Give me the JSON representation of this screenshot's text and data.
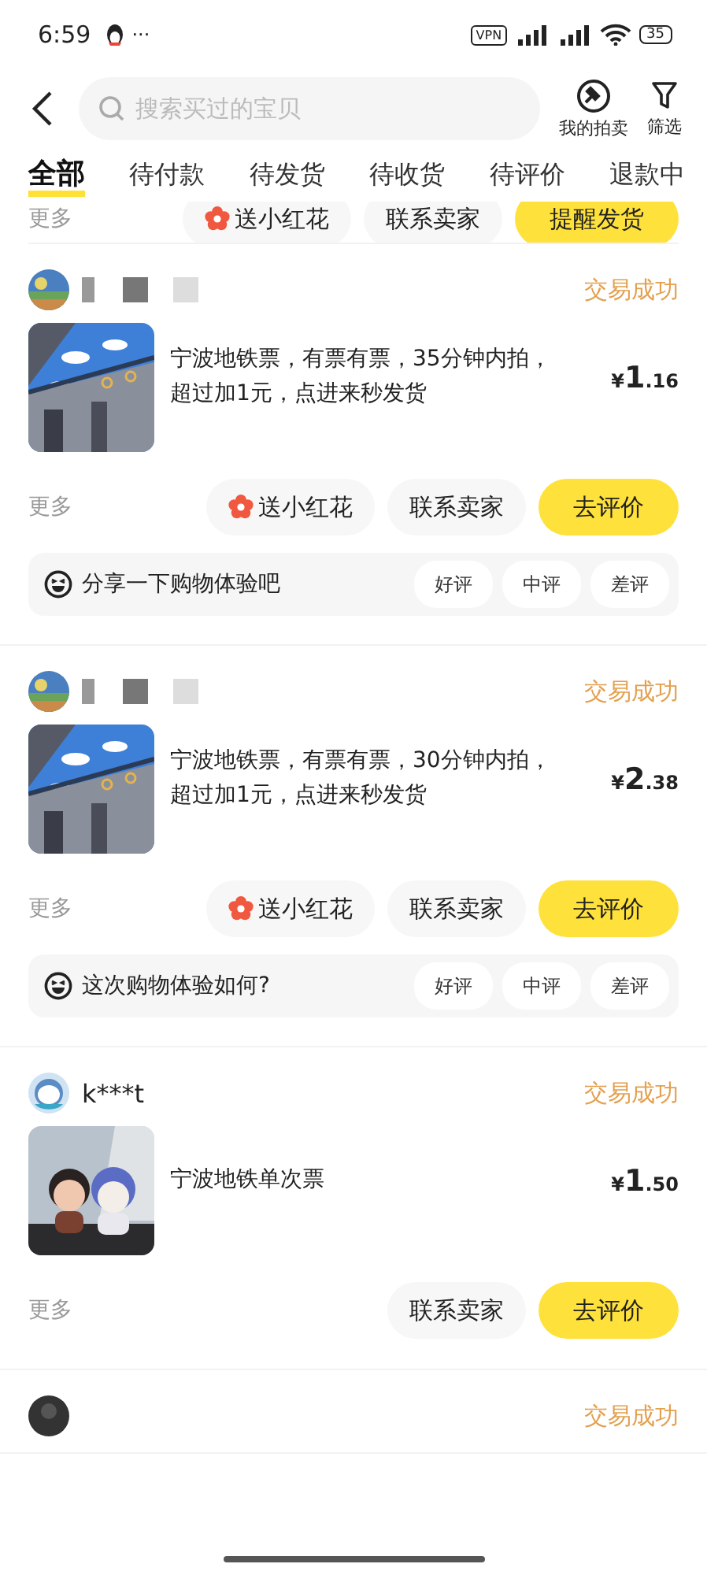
{
  "status_bar": {
    "time": "6:59",
    "more": "···",
    "vpn": "VPN",
    "battery": "35"
  },
  "header": {
    "search": {
      "placeholder": "搜索买过的宝贝"
    },
    "actions": [
      {
        "kind": "auction",
        "label": "我的拍卖"
      },
      {
        "kind": "filter",
        "label": "筛选"
      }
    ]
  },
  "tabs": [
    {
      "label": "全部",
      "selected": true
    },
    {
      "label": "待付款",
      "selected": false
    },
    {
      "label": "待发货",
      "selected": false
    },
    {
      "label": "待收货",
      "selected": false
    },
    {
      "label": "待评价",
      "selected": false
    },
    {
      "label": "退款中",
      "selected": false
    }
  ],
  "partial_actions": {
    "more": "更多",
    "buttons": [
      {
        "kind": "flower",
        "label": "送小红花"
      },
      {
        "kind": "plain",
        "label": "联系卖家"
      },
      {
        "kind": "primary",
        "label": "提醒发货"
      }
    ]
  },
  "orders": [
    {
      "seller": {
        "masked": true
      },
      "status": "交易成功",
      "product": {
        "kind": "picture",
        "title": "宁波地铁票，有票有票，35分钟内拍，超过加1元，点进来秒发货",
        "price": {
          "symbol": "¥",
          "integer": "1",
          "decimal": ".16"
        }
      },
      "more": "更多",
      "buttons": [
        {
          "kind": "flower",
          "label": "送小红花"
        },
        {
          "kind": "plain",
          "label": "联系卖家"
        },
        {
          "kind": "primary",
          "label": "去评价"
        }
      ],
      "feedback": {
        "prompt": "分享一下购物体验吧",
        "options": [
          "好评",
          "中评",
          "差评"
        ]
      }
    },
    {
      "seller": {
        "masked": true
      },
      "status": "交易成功",
      "product": {
        "kind": "picture",
        "title": "宁波地铁票，有票有票，30分钟内拍，超过加1元，点进来秒发货",
        "price": {
          "symbol": "¥",
          "integer": "2",
          "decimal": ".38"
        }
      },
      "more": "更多",
      "buttons": [
        {
          "kind": "flower",
          "label": "送小红花"
        },
        {
          "kind": "plain",
          "label": "联系卖家"
        },
        {
          "kind": "primary",
          "label": "去评价"
        }
      ],
      "feedback": {
        "prompt": "这次购物体验如何?",
        "options": [
          "好评",
          "中评",
          "差评"
        ]
      }
    },
    {
      "seller": {
        "name": "k***t",
        "masked": false
      },
      "status": "交易成功",
      "product": {
        "kind": "picture",
        "title": "宁波地铁单次票",
        "price": {
          "symbol": "¥",
          "integer": "1",
          "decimal": ".50"
        }
      },
      "more": "更多",
      "buttons": [
        {
          "kind": "plain",
          "label": "联系卖家"
        },
        {
          "kind": "primary",
          "label": "去评价"
        }
      ]
    },
    {
      "seller": {
        "masked": false
      },
      "status": "交易成功"
    }
  ]
}
